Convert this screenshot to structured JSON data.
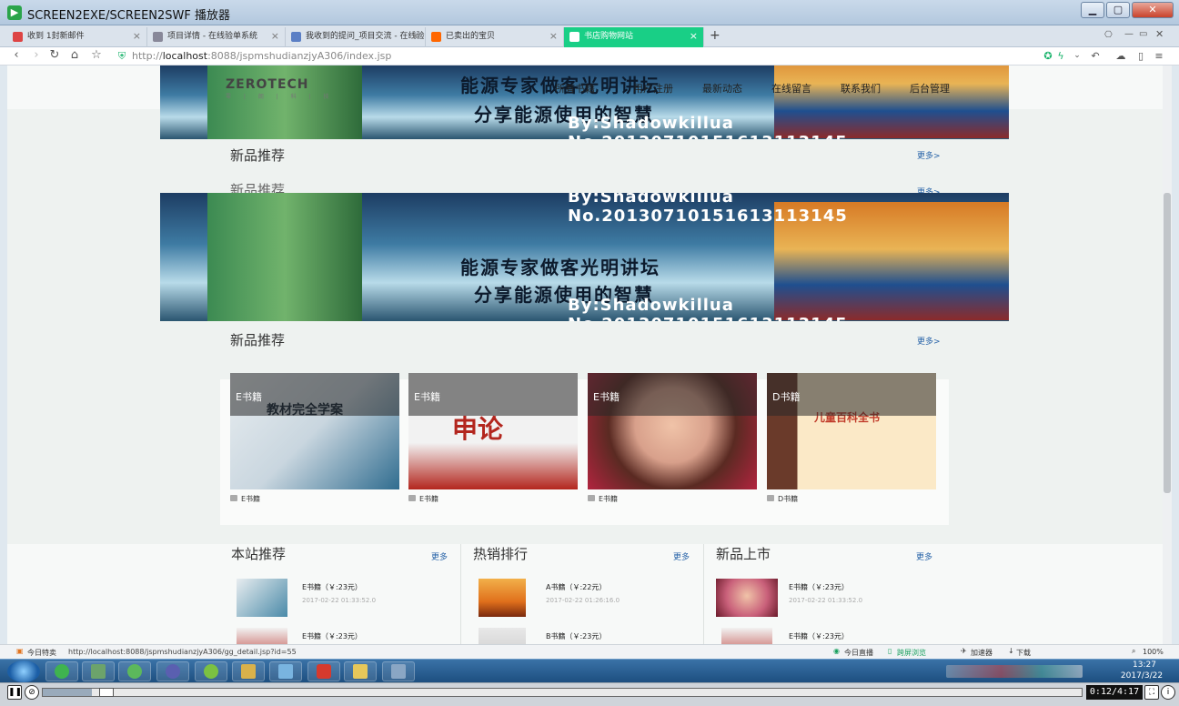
{
  "window": {
    "title": "SCREEN2EXE/SCREEN2SWF 播放器",
    "minimize": "▁",
    "maximize": "▢",
    "close": "✕"
  },
  "tabs": [
    {
      "label": "收到 1封新邮件",
      "icon": "gmail-icon",
      "color": "#d44"
    },
    {
      "label": "项目详情 - 在线验单系统",
      "icon": "page-icon",
      "color": "#889"
    },
    {
      "label": "我收到的提问_项目交流 - 在线验",
      "icon": "quill-icon",
      "color": "#5b7fc5"
    },
    {
      "label": "已卖出的宝贝",
      "icon": "taobao-icon",
      "color": "#f60"
    },
    {
      "label": "书店购物网站",
      "icon": "page-icon",
      "color": "#fff",
      "active": true
    }
  ],
  "newtab": "+",
  "address": {
    "prefix": "http://",
    "host": "localhost",
    "rest": ":8088/jspmshudianzjyA306/index.jsp"
  },
  "site": {
    "logo": "ZEROTECH",
    "logo_sub": "零 | 朗 | 科 | 技",
    "nav": [
      "所有书籍",
      "用户注册",
      "最新动态",
      "在线留言",
      "联系我们",
      "后台管理"
    ],
    "banner": {
      "line1": "能源专家做客光明讲坛",
      "line2": "分享能源使用的智慧",
      "line3": "By:Shadowkillua  No.20130710151613113145"
    },
    "section_new": "新品推荐",
    "more": "更多>",
    "books": [
      {
        "overlay": "E书籍",
        "tag": "E书籍",
        "cover_title": "教材完全学案",
        "c1": "#c9d6df",
        "c2": "#2f6c8f"
      },
      {
        "overlay": "E书籍",
        "tag": "E书籍",
        "cover_title": "申论",
        "c1": "#f2f2f2",
        "c2": "#b3261e"
      },
      {
        "overlay": "E书籍",
        "tag": "E书籍",
        "cover_title": "",
        "c1": "#d8a08b",
        "c2": "#b2243f"
      },
      {
        "overlay": "D书籍",
        "tag": "D书籍",
        "cover_title": "儿童百科全书",
        "c1": "#fbe9c7",
        "c2": "#c13b2a"
      }
    ],
    "columns": [
      {
        "title": "本站推荐",
        "more": "更多",
        "items": [
          {
            "name": "E书籍（￥:23元）",
            "date": "2017-02-22 01:33:52.0",
            "c": "#4a8aa8"
          },
          {
            "name": "E书籍（￥:23元）",
            "date": "",
            "c": "#b3261e"
          }
        ]
      },
      {
        "title": "热销排行",
        "more": "更多",
        "items": [
          {
            "name": "A书籍（￥:22元）",
            "date": "2017-02-22 01:26:16.0",
            "c": "#e0701c"
          },
          {
            "name": "B书籍（￥:23元）",
            "date": "",
            "c": "#c7c7c7"
          }
        ]
      },
      {
        "title": "新品上市",
        "more": "更多",
        "items": [
          {
            "name": "E书籍（￥:23元）",
            "date": "2017-02-22 01:33:52.0",
            "c": "#c9607a"
          },
          {
            "name": "E书籍（￥:23元）",
            "date": "",
            "c": "#b3261e"
          }
        ]
      }
    ]
  },
  "status": {
    "left": "今日特卖",
    "url": "http://localhost:8088/jspmshudianzjyA306/gg_detail.jsp?id=55",
    "live": "今日直播",
    "split": "跨屏浏览",
    "accel": "加速器",
    "download": "下载",
    "zoom": "100%"
  },
  "taskbar": {
    "time": "13:27",
    "date": "2017/3/22"
  },
  "player": {
    "time": "0:12/4:17",
    "progress": 0.047
  }
}
